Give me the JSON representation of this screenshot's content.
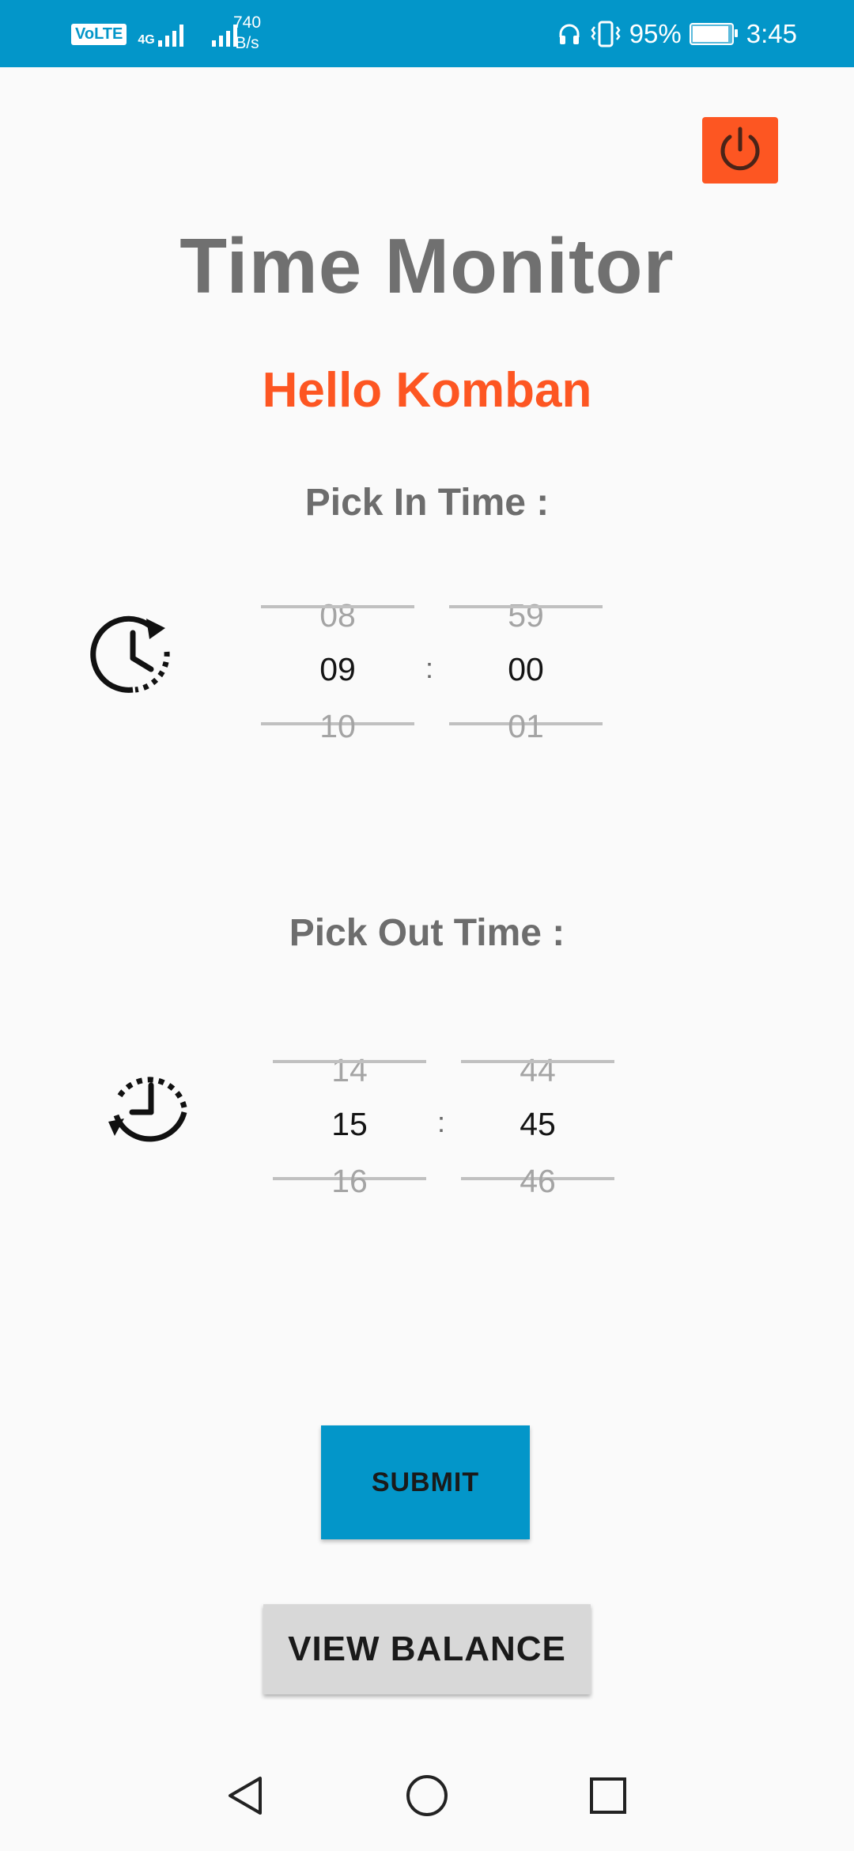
{
  "status_bar": {
    "volte": "VoLTE",
    "network_type": "4G",
    "net_speed_value": "740",
    "net_speed_unit": "B/s",
    "battery_percent": "95%",
    "battery_level": 0.95,
    "time": "3:45"
  },
  "app": {
    "title": "Time Monitor",
    "greeting": "Hello Komban"
  },
  "in_time": {
    "label": "Pick In Time :",
    "hour": {
      "prev": "08",
      "current": "09",
      "next": "10"
    },
    "minute": {
      "prev": "59",
      "current": "00",
      "next": "01"
    },
    "separator": ":"
  },
  "out_time": {
    "label": "Pick Out Time :",
    "hour": {
      "prev": "14",
      "current": "15",
      "next": "16"
    },
    "minute": {
      "prev": "44",
      "current": "45",
      "next": "46"
    },
    "separator": ":"
  },
  "buttons": {
    "submit": "SUBMIT",
    "view_balance": "VIEW BALANCE"
  },
  "colors": {
    "status_bar": "#0396c9",
    "accent_orange": "#fd5622",
    "title_gray": "#707070",
    "submit_blue": "#0396c9",
    "balance_gray": "#d8d8d8"
  },
  "icons": {
    "power": "power-icon",
    "in_clock": "clock-forward-icon",
    "out_clock": "clock-backward-icon",
    "nav_back": "back-triangle-icon",
    "nav_home": "home-circle-icon",
    "nav_recents": "recents-square-icon"
  }
}
